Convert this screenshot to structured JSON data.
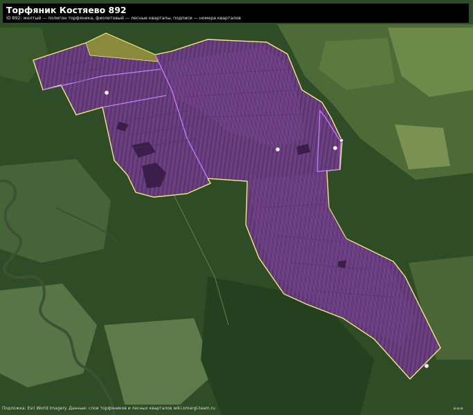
{
  "title": "Торфяник Костяево 892",
  "subtitle": "ID 892: желтый — полигон торфяника, фиолетовый — лесные кварталы, подписи — номера кварталов",
  "attribution": "Подложка: Esri World Imagery. Данные: слои торфяников и лесных кварталов wiki.omargl-team.ru",
  "watermark": "≡≡≡",
  "colors": {
    "peat_outline": "#f3ee7a",
    "quarter_outline": "#c77dff",
    "quarter_fill": "#8a4fa8",
    "forest": "#2d4a25",
    "field": "#6f8a4c",
    "river": "#3b4f3a"
  },
  "quarter_labels": [
    "",
    "",
    "",
    "",
    ""
  ]
}
